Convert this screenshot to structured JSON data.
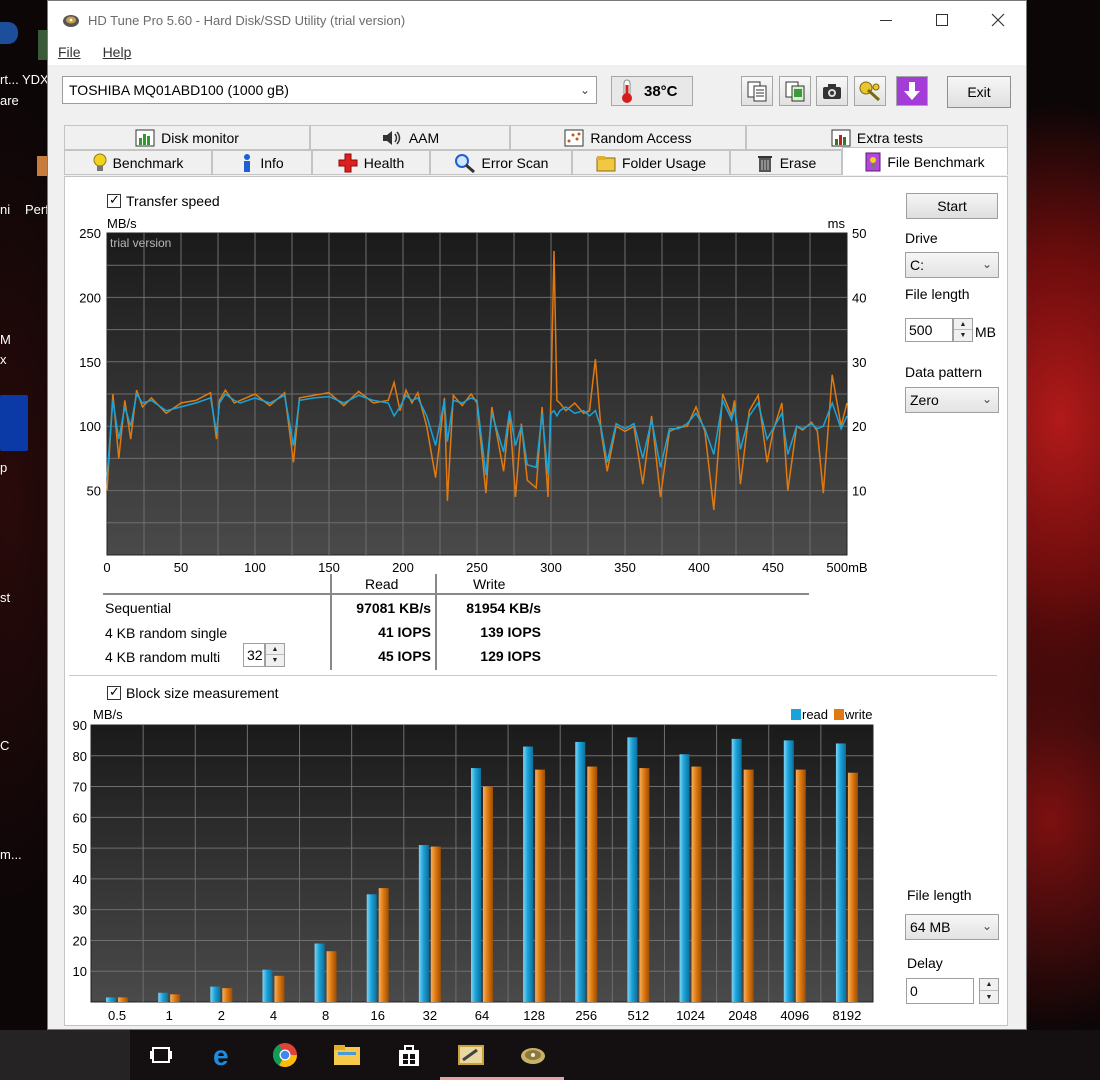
{
  "desktop": {
    "labels": [
      "rt...",
      "YDX",
      "are",
      "ni",
      "Perf",
      "M",
      "x",
      "p",
      "st",
      "C",
      "m..."
    ]
  },
  "window": {
    "title": "HD Tune Pro 5.60 - Hard Disk/SSD Utility (trial version)",
    "menu": [
      "File",
      "Help"
    ],
    "drive": "TOSHIBA MQ01ABD100 (1000 gB)",
    "temperature": "38°C",
    "exit_label": "Exit"
  },
  "tabs": {
    "row1": [
      "Disk monitor",
      "AAM",
      "Random Access",
      "Extra tests"
    ],
    "row2": [
      "Benchmark",
      "Info",
      "Health",
      "Error Scan",
      "Folder Usage",
      "Erase",
      "File Benchmark"
    ],
    "selected": "File Benchmark"
  },
  "side": {
    "start_label": "Start",
    "drive_label": "Drive",
    "drive_value": "C:",
    "file_length_label": "File length",
    "file_length_value": "500",
    "file_length_unit": "MB",
    "data_pattern_label": "Data pattern",
    "data_pattern_value": "Zero",
    "block_file_length_label": "File length",
    "block_file_length_value": "64 MB",
    "delay_label": "Delay",
    "delay_value": "0"
  },
  "transfer": {
    "checkbox_label": "Transfer speed",
    "watermark": "trial version"
  },
  "results": {
    "col_read": "Read",
    "col_write": "Write",
    "rows": [
      {
        "label": "Sequential",
        "read": "97081 KB/s",
        "write": "81954 KB/s"
      },
      {
        "label": "4 KB random single",
        "read": "41 IOPS",
        "write": "139 IOPS"
      },
      {
        "label": "4 KB random multi",
        "read": "45 IOPS",
        "write": "129 IOPS"
      }
    ],
    "queue_depth": "32"
  },
  "block": {
    "checkbox_label": "Block size measurement"
  },
  "colors": {
    "read": "#1aa3d9",
    "write": "#e07a10",
    "plot_bg_top": "#1a1a1a",
    "plot_bg_bottom": "#4a4a4a",
    "grid": "#6e6e6e"
  },
  "chart_data": [
    {
      "type": "line",
      "ylabel": "MB/s",
      "y2label": "ms",
      "xunit": "mB",
      "xlim": [
        0,
        500
      ],
      "ylim": [
        0,
        250
      ],
      "y2lim": [
        0,
        50
      ],
      "xticks": [
        "0",
        "50",
        "100",
        "150",
        "200",
        "250",
        "300",
        "350",
        "400",
        "450",
        "500mB"
      ],
      "yticks": [
        "50",
        "100",
        "150",
        "200",
        "250"
      ],
      "y2ticks": [
        "10",
        "20",
        "30",
        "40",
        "50"
      ],
      "grid": true,
      "series": [
        {
          "name": "read",
          "x": [
            0,
            4,
            8,
            12,
            16,
            20,
            24,
            30,
            40,
            50,
            60,
            70,
            74,
            76,
            80,
            86,
            90,
            100,
            110,
            120,
            126,
            130,
            140,
            150,
            160,
            170,
            180,
            190,
            194,
            198,
            202,
            206,
            210,
            216,
            222,
            228,
            230,
            234,
            240,
            246,
            250,
            256,
            260,
            264,
            268,
            272,
            276,
            280,
            284,
            290,
            294,
            298,
            300,
            302,
            304,
            306,
            310,
            316,
            322,
            326,
            330,
            334,
            338,
            344,
            350,
            356,
            362,
            368,
            374,
            380,
            386,
            392,
            398,
            404,
            410,
            416,
            422,
            424,
            428,
            434,
            440,
            446,
            450,
            456,
            460,
            466,
            470,
            476,
            480,
            484,
            490,
            496,
            500
          ],
          "y": [
            60,
            120,
            90,
            115,
            100,
            125,
            118,
            120,
            112,
            115,
            118,
            122,
            95,
            118,
            125,
            120,
            118,
            122,
            118,
            124,
            85,
            120,
            122,
            123,
            118,
            124,
            120,
            118,
            108,
            115,
            124,
            120,
            122,
            108,
            85,
            120,
            88,
            120,
            118,
            122,
            120,
            62,
            110,
            95,
            80,
            112,
            85,
            100,
            70,
            68,
            110,
            62,
            110,
            112,
            108,
            112,
            115,
            110,
            112,
            108,
            112,
            98,
            72,
            102,
            98,
            102,
            75,
            105,
            68,
            98,
            98,
            102,
            110,
            98,
            78,
            120,
            105,
            115,
            82,
            108,
            118,
            90,
            98,
            110,
            78,
            100,
            98,
            102,
            98,
            100,
            118,
            98,
            108
          ]
        },
        {
          "name": "write",
          "x": [
            0,
            4,
            8,
            12,
            16,
            20,
            24,
            30,
            40,
            50,
            60,
            70,
            74,
            76,
            80,
            86,
            90,
            100,
            110,
            120,
            126,
            130,
            140,
            150,
            160,
            170,
            180,
            190,
            194,
            198,
            202,
            206,
            210,
            216,
            222,
            228,
            230,
            234,
            240,
            246,
            250,
            256,
            260,
            264,
            268,
            272,
            276,
            280,
            284,
            290,
            294,
            298,
            300,
            302,
            304,
            306,
            310,
            316,
            322,
            326,
            330,
            334,
            338,
            344,
            350,
            356,
            362,
            368,
            374,
            380,
            386,
            392,
            398,
            404,
            410,
            416,
            422,
            424,
            428,
            434,
            440,
            446,
            450,
            456,
            460,
            466,
            470,
            476,
            480,
            484,
            490,
            496,
            500
          ],
          "y": [
            50,
            125,
            75,
            120,
            90,
            128,
            115,
            122,
            110,
            118,
            120,
            126,
            90,
            120,
            128,
            118,
            120,
            125,
            116,
            126,
            72,
            122,
            124,
            126,
            116,
            127,
            118,
            120,
            134,
            112,
            128,
            118,
            126,
            100,
            60,
            122,
            42,
            124,
            116,
            125,
            118,
            48,
            115,
            90,
            65,
            110,
            45,
            102,
            58,
            52,
            115,
            45,
            124,
            236,
            120,
            118,
            112,
            118,
            110,
            112,
            152,
            95,
            65,
            100,
            96,
            100,
            55,
            108,
            45,
            96,
            99,
            100,
            115,
            96,
            35,
            125,
            108,
            120,
            55,
            112,
            124,
            72,
            96,
            118,
            50,
            100,
            97,
            103,
            96,
            48,
            140,
            100,
            118
          ]
        }
      ]
    },
    {
      "type": "bar",
      "ylabel": "MB/s",
      "ylim": [
        0,
        90
      ],
      "yticks": [
        "10",
        "20",
        "30",
        "40",
        "50",
        "60",
        "70",
        "80",
        "90"
      ],
      "categories": [
        "0.5",
        "1",
        "2",
        "4",
        "8",
        "16",
        "32",
        "64",
        "128",
        "256",
        "512",
        "1024",
        "2048",
        "4096",
        "8192"
      ],
      "legend": "top-right",
      "series": [
        {
          "name": "read",
          "values": [
            1.5,
            3,
            5,
            10.5,
            19,
            35,
            51,
            76,
            83,
            84.5,
            86,
            80.5,
            85.5,
            85,
            84
          ]
        },
        {
          "name": "write",
          "values": [
            1.5,
            2.5,
            4.5,
            8.5,
            16.5,
            37,
            50.5,
            70,
            75.5,
            76.5,
            76,
            76.5,
            75.5,
            75.5,
            74.5
          ]
        }
      ]
    }
  ]
}
